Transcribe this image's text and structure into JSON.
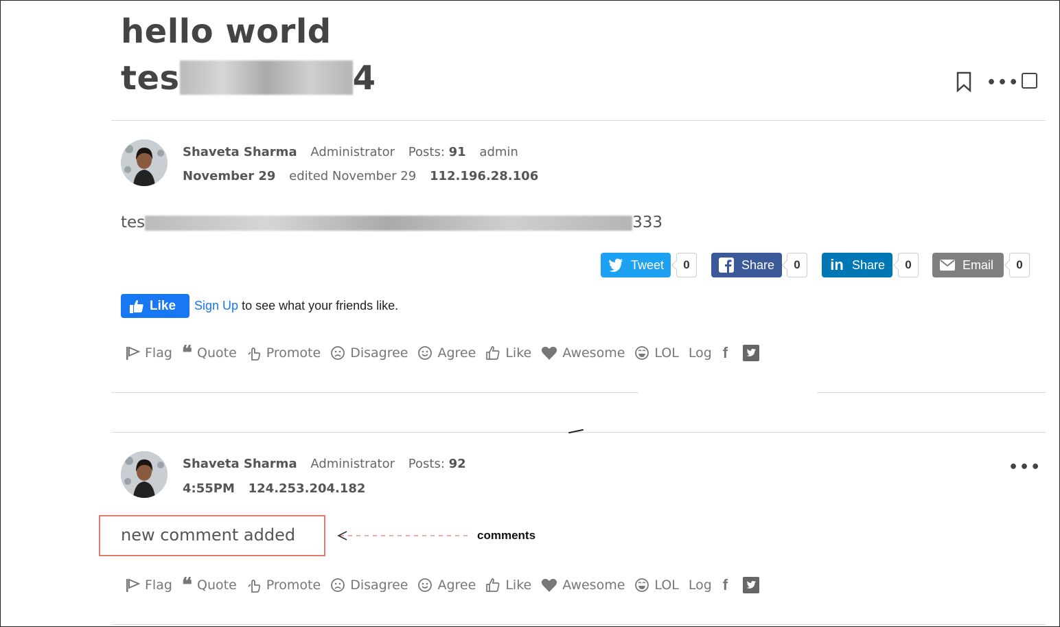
{
  "discussion": {
    "title_line1": "hello world",
    "title_line2_start": "tes",
    "title_line2_end": "4"
  },
  "header_icons": [
    "bookmark-icon",
    "more-options-icon",
    "checkbox-icon"
  ],
  "post": {
    "author": "Shaveta Sharma",
    "role": "Administrator",
    "posts_label": "Posts:",
    "posts_count": "91",
    "extra_role": "admin",
    "date": "November 29",
    "edited": "edited November 29",
    "ip": "112.196.28.106",
    "body_start": "tes",
    "body_end": "333"
  },
  "share_buttons": [
    {
      "label": "Tweet",
      "count": "0",
      "color": "#1da1f2"
    },
    {
      "label": "Share",
      "count": "0",
      "color": "#3b5998"
    },
    {
      "label": "Share",
      "count": "0",
      "color": "#0077b5"
    },
    {
      "label": "Email",
      "count": "0",
      "color": "#7f7f7f"
    }
  ],
  "fb_like": {
    "button": "Like",
    "signup": "Sign Up",
    "text": "to see what your friends like."
  },
  "reactions": {
    "flag": "Flag",
    "quote": "Quote",
    "promote": "Promote",
    "disagree": "Disagree",
    "agree": "Agree",
    "like": "Like",
    "awesome": "Awesome",
    "lol": "LOL",
    "log": "Log"
  },
  "comment": {
    "author": "Shaveta Sharma",
    "role": "Administrator",
    "posts_label": "Posts:",
    "posts_count": "92",
    "time": "4:55PM",
    "ip": "124.253.204.182",
    "body": "new comment added"
  },
  "annotation": {
    "label": "comments",
    "color": "#e27a6c"
  }
}
